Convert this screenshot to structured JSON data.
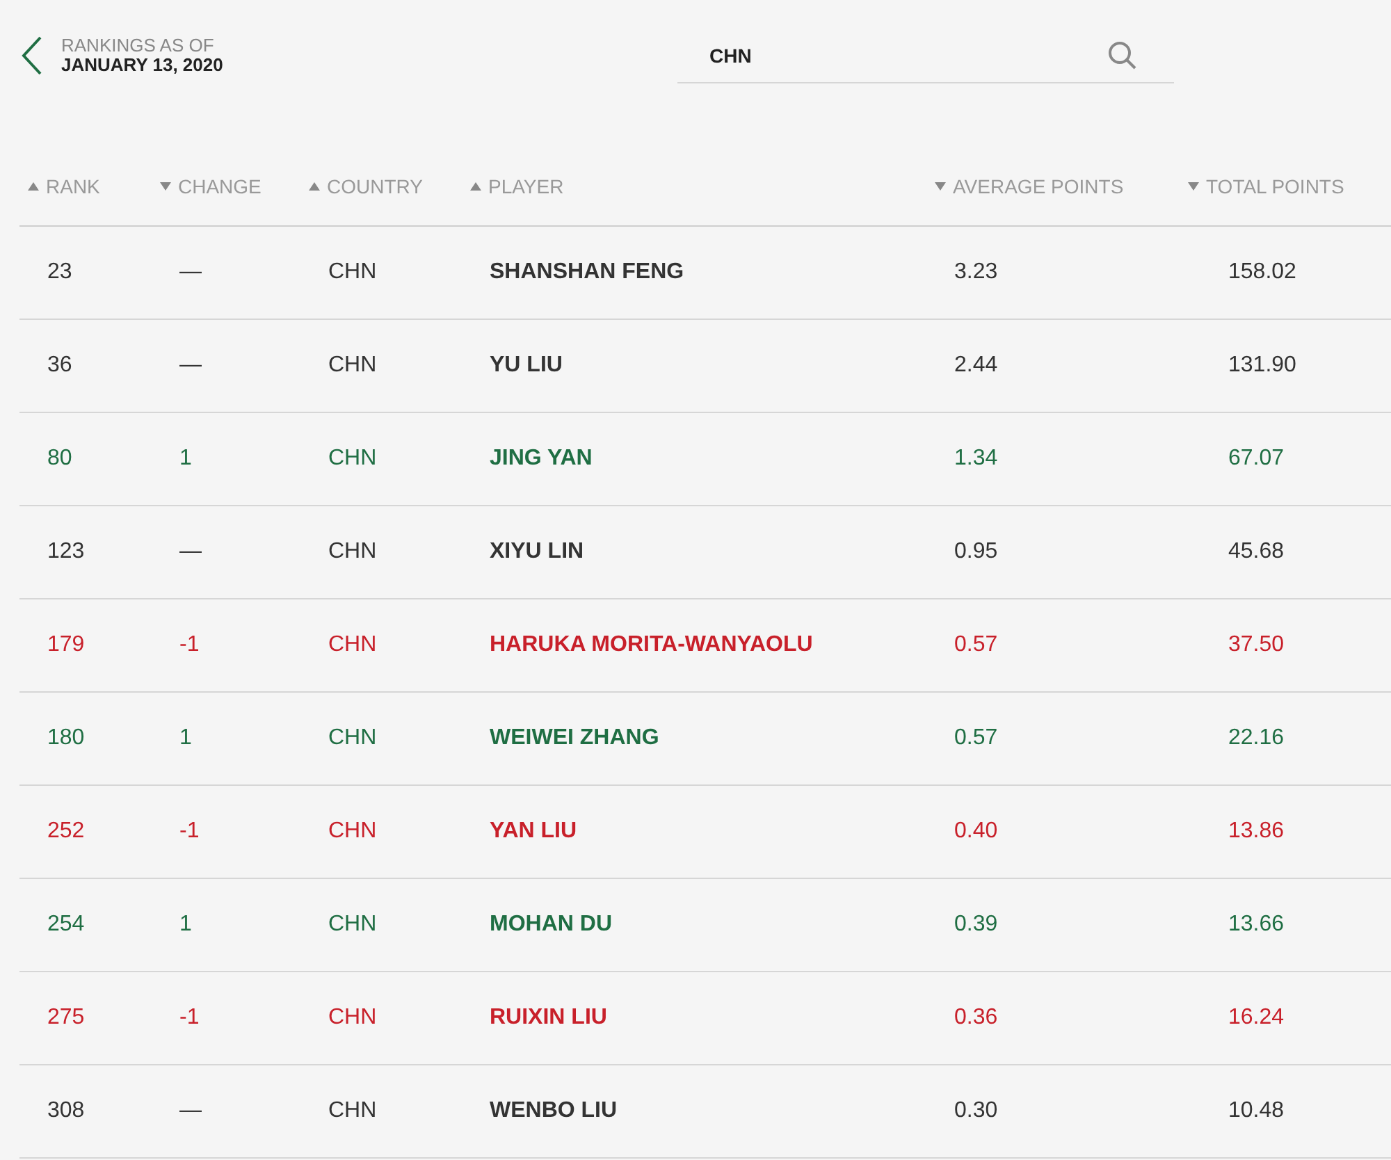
{
  "header": {
    "caption": "RANKINGS AS OF",
    "date": "JANUARY 13, 2020"
  },
  "search": {
    "value": "CHN"
  },
  "table": {
    "columns": [
      {
        "label": "RANK",
        "descending": false
      },
      {
        "label": "CHANGE",
        "descending": true
      },
      {
        "label": "COUNTRY",
        "descending": false
      },
      {
        "label": "PLAYER",
        "descending": false
      },
      {
        "label": "AVERAGE POINTS",
        "descending": true
      },
      {
        "label": "TOTAL POINTS",
        "descending": true
      }
    ],
    "rows": [
      {
        "rank": "23",
        "change": "—",
        "country": "CHN",
        "player": "SHANSHAN FENG",
        "average": "3.23",
        "total": "158.02",
        "color": "#333333"
      },
      {
        "rank": "36",
        "change": "—",
        "country": "CHN",
        "player": "YU LIU",
        "average": "2.44",
        "total": "131.90",
        "color": "#333333"
      },
      {
        "rank": "80",
        "change": "1",
        "country": "CHN",
        "player": "JING YAN",
        "average": "1.34",
        "total": "67.07",
        "color": "#1f6e43"
      },
      {
        "rank": "123",
        "change": "—",
        "country": "CHN",
        "player": "XIYU LIN",
        "average": "0.95",
        "total": "45.68",
        "color": "#333333"
      },
      {
        "rank": "179",
        "change": "-1",
        "country": "CHN",
        "player": "HARUKA MORITA-WANYAOLU",
        "average": "0.57",
        "total": "37.50",
        "color": "#c8202a"
      },
      {
        "rank": "180",
        "change": "1",
        "country": "CHN",
        "player": "WEIWEI ZHANG",
        "average": "0.57",
        "total": "22.16",
        "color": "#1f6e43"
      },
      {
        "rank": "252",
        "change": "-1",
        "country": "CHN",
        "player": "YAN LIU",
        "average": "0.40",
        "total": "13.86",
        "color": "#c8202a"
      },
      {
        "rank": "254",
        "change": "1",
        "country": "CHN",
        "player": "MOHAN DU",
        "average": "0.39",
        "total": "13.66",
        "color": "#1f6e43"
      },
      {
        "rank": "275",
        "change": "-1",
        "country": "CHN",
        "player": "RUIXIN LIU",
        "average": "0.36",
        "total": "16.24",
        "color": "#c8202a"
      },
      {
        "rank": "308",
        "change": "—",
        "country": "CHN",
        "player": "WENBO LIU",
        "average": "0.30",
        "total": "10.48",
        "color": "#333333"
      }
    ]
  }
}
